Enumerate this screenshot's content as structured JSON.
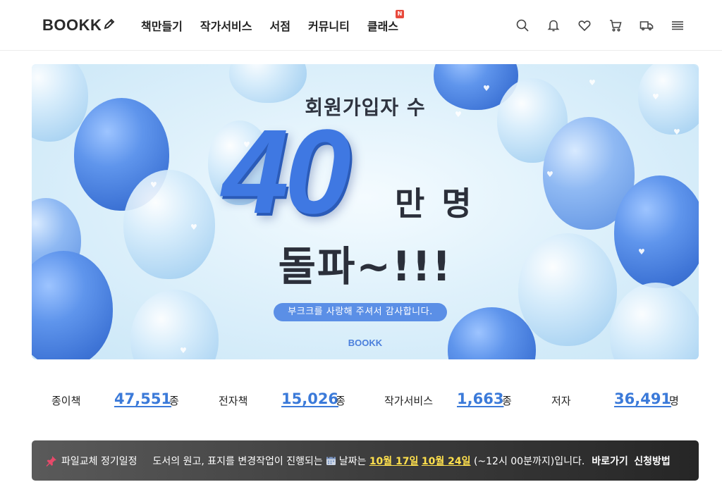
{
  "header": {
    "logo": "BOOKK",
    "nav": [
      {
        "label": "책만들기"
      },
      {
        "label": "작가서비스"
      },
      {
        "label": "서점"
      },
      {
        "label": "커뮤니티"
      },
      {
        "label": "클래스",
        "badge": "N"
      }
    ],
    "icons": [
      "search-icon",
      "bell-icon",
      "heart-icon",
      "cart-icon",
      "delivery-truck-icon",
      "menu-icon"
    ]
  },
  "banner": {
    "headline": "회원가입자 수",
    "number": "40",
    "unit": "만 명",
    "break_text": "돌파~!!!",
    "thanks": "부크크를 사랑해 주셔서 감사합니다.",
    "logo": "BOOKK",
    "colors": {
      "accent": "#3f78e2",
      "pill": "#5b8fe6",
      "background": "#dff1fb"
    }
  },
  "stats": [
    {
      "label": "종이책",
      "value": "47,551",
      "unit": "종"
    },
    {
      "label": "전자책",
      "value": "15,026",
      "unit": "종"
    },
    {
      "label": "작가서비스",
      "value": "1,663",
      "unit": "종"
    },
    {
      "label": "저자",
      "value": "36,491",
      "unit": "명"
    }
  ],
  "notice": {
    "title": "파일교체 정기일정",
    "text_before": "도서의 원고, 표지를 변경작업이 진행되는",
    "text_date_prefix": "날짜는",
    "date1": "10월 17일",
    "date2": "10월 24일",
    "text_after": "(~12시 00분까지)입니다.",
    "link1": "바로가기",
    "link2": "신청방법",
    "colors": {
      "date": "#ffe04d",
      "stat_value": "#3b7ad9"
    }
  }
}
